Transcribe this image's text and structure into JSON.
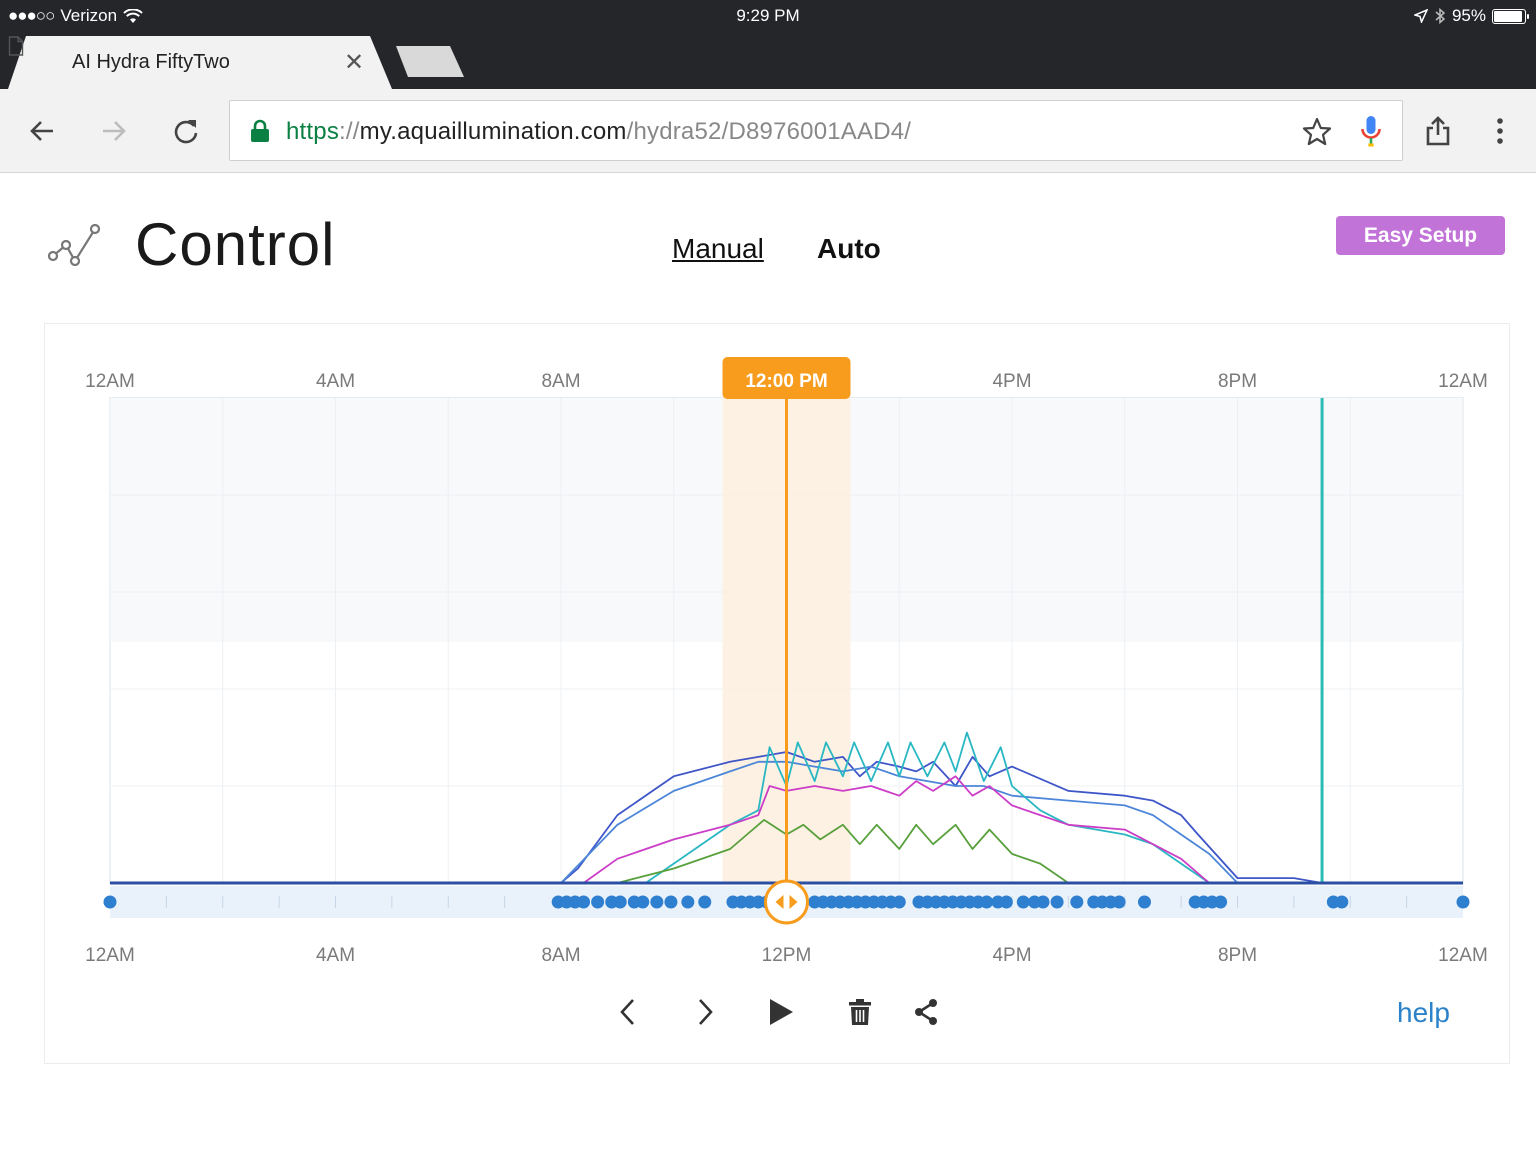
{
  "status_bar": {
    "carrier": "Verizon",
    "time": "9:29 PM",
    "battery": "95%"
  },
  "tab": {
    "title": "AI Hydra FiftyTwo"
  },
  "omnibox": {
    "scheme": "https",
    "separator": "://",
    "host": "my.aquaillumination.com",
    "path": "/hydra52/D8976001AAD4/"
  },
  "page": {
    "title": "Control",
    "mode_manual": "Manual",
    "mode_auto": "Auto",
    "easy_setup": "Easy Setup",
    "help": "help"
  },
  "colors": {
    "accent_orange": "#f79c1c",
    "easy_setup_purple": "#c273d8",
    "help_blue": "#2b82c9",
    "point_blue": "#2f7fd0",
    "moon_teal": "#2bbcb5"
  },
  "chart_data": {
    "type": "line",
    "x_unit": "hour of day",
    "xlim": [
      0,
      24
    ],
    "ylim": [
      0,
      100
    ],
    "top_tick_labels": [
      "12AM",
      "4AM",
      "8AM",
      "12:00 PM",
      "4PM",
      "8PM",
      "12AM"
    ],
    "bottom_tick_labels": [
      "12AM",
      "4AM",
      "8AM",
      "12PM",
      "4PM",
      "8PM",
      "12AM"
    ],
    "playhead_label": "12:00 PM",
    "playhead_hour": 12,
    "moonlight_marker_hour": 21.5,
    "series": [
      {
        "color": "#3f56c8",
        "x": [
          0,
          8,
          8.3,
          9,
          10,
          11,
          11.5,
          12,
          12.5,
          13,
          13.3,
          13.6,
          14,
          14.3,
          14.6,
          15,
          15.3,
          15.6,
          16,
          17,
          18,
          18.5,
          19,
          19.3,
          20,
          21,
          21.5,
          24
        ],
        "y": [
          0,
          0,
          3,
          14,
          22,
          25,
          26,
          27,
          25,
          26,
          22,
          25,
          24,
          23,
          25,
          20,
          26,
          22,
          24,
          19,
          18,
          17,
          14,
          10,
          1,
          1,
          0,
          0
        ]
      },
      {
        "color": "#4d86d9",
        "x": [
          0,
          8,
          8.5,
          9,
          10,
          11,
          11.5,
          12,
          12.5,
          13,
          13.5,
          14,
          14.5,
          15,
          15.5,
          16,
          17,
          18,
          18.5,
          19,
          19.5,
          20,
          24
        ],
        "y": [
          0,
          0,
          6,
          12,
          19,
          23,
          25,
          25,
          24,
          23,
          24,
          22,
          21,
          20,
          20,
          18,
          17,
          16,
          14,
          10,
          6,
          0,
          0
        ]
      },
      {
        "color": "#29b7c3",
        "x": [
          0,
          9.5,
          10,
          11,
          11.5,
          11.7,
          12,
          12.2,
          12.5,
          12.7,
          13,
          13.2,
          13.5,
          13.8,
          14,
          14.2,
          14.5,
          14.8,
          15,
          15.2,
          15.5,
          15.8,
          16,
          16.5,
          17,
          18,
          18.5,
          19,
          19.5,
          24
        ],
        "y": [
          0,
          0,
          4,
          12,
          15,
          28,
          20,
          29,
          21,
          29,
          22,
          29,
          21,
          29,
          22,
          29,
          22,
          29,
          23,
          31,
          21,
          28,
          20,
          15,
          12,
          10,
          8,
          4,
          0,
          0
        ]
      },
      {
        "color": "#cc3ec7",
        "x": [
          0,
          8.4,
          9,
          10,
          11,
          11.5,
          11.7,
          12,
          12.5,
          13,
          13.5,
          14,
          14.3,
          14.6,
          15,
          15.3,
          15.6,
          16,
          16.5,
          17,
          18,
          19,
          19.5,
          24
        ],
        "y": [
          0,
          0,
          5,
          9,
          12,
          14,
          20,
          19,
          20,
          19,
          20,
          18,
          21,
          19,
          22,
          18,
          20,
          16,
          14,
          12,
          11,
          5,
          0,
          0
        ]
      },
      {
        "color": "#58a03c",
        "x": [
          0,
          9,
          10,
          11,
          11.3,
          11.6,
          12,
          12.3,
          12.6,
          13,
          13.3,
          13.6,
          14,
          14.3,
          14.6,
          15,
          15.3,
          15.6,
          16,
          16.5,
          17,
          18,
          24
        ],
        "y": [
          0,
          0,
          3,
          7,
          10,
          13,
          10,
          12,
          9,
          12,
          8,
          12,
          7,
          12,
          8,
          12,
          7,
          11,
          6,
          4,
          0,
          0,
          0
        ]
      }
    ],
    "points_hours": [
      0,
      7.95,
      8.1,
      8.25,
      8.4,
      8.65,
      8.9,
      9.05,
      9.3,
      9.45,
      9.7,
      9.95,
      10.25,
      10.55,
      11.05,
      11.2,
      11.35,
      11.5,
      11.65,
      12,
      12.5,
      12.65,
      12.8,
      12.95,
      13.1,
      13.25,
      13.4,
      13.55,
      13.7,
      13.85,
      14,
      14.35,
      14.5,
      14.65,
      14.8,
      14.95,
      15.1,
      15.25,
      15.4,
      15.55,
      15.75,
      15.9,
      16.2,
      16.4,
      16.55,
      16.8,
      17.15,
      17.45,
      17.6,
      17.75,
      17.9,
      18.35,
      19.25,
      19.4,
      19.55,
      19.7,
      21.7,
      21.85,
      24
    ]
  }
}
